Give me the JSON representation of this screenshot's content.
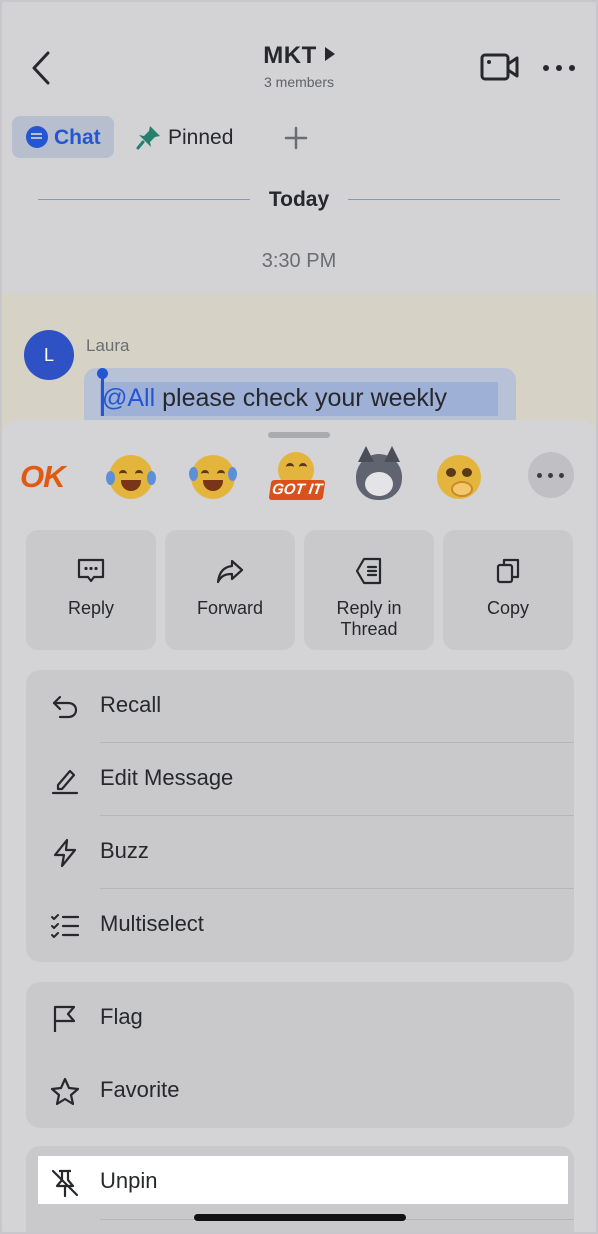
{
  "header": {
    "title": "MKT",
    "subtitle": "3 members"
  },
  "tabs": [
    {
      "label": "Chat"
    },
    {
      "label": "Pinned"
    }
  ],
  "date_divider": "Today",
  "timestamp": "3:30 PM",
  "message": {
    "avatar_initial": "L",
    "sender": "Laura",
    "mention": "@All",
    "text": " please check your weekly"
  },
  "reactions": [
    {
      "icon": "ok-sticker",
      "text": "OK"
    },
    {
      "icon": "crying-laughing-emoji"
    },
    {
      "icon": "tears-of-joy-emoji"
    },
    {
      "icon": "got-it-sticker",
      "text": "GOT IT"
    },
    {
      "icon": "husky-emoji"
    },
    {
      "icon": "pleading-face-emoji"
    },
    {
      "icon": "more-reactions-icon"
    }
  ],
  "actions": [
    {
      "label": "Reply",
      "icon": "reply-icon"
    },
    {
      "label": "Forward",
      "icon": "forward-icon"
    },
    {
      "label": "Reply in Thread",
      "icon": "thread-icon"
    },
    {
      "label": "Copy",
      "icon": "copy-icon"
    }
  ],
  "menu_group_1": [
    {
      "label": "Recall",
      "icon": "undo-icon"
    },
    {
      "label": "Edit Message",
      "icon": "pencil-icon"
    },
    {
      "label": "Buzz",
      "icon": "lightning-icon"
    },
    {
      "label": "Multiselect",
      "icon": "checklist-icon"
    }
  ],
  "menu_group_2": [
    {
      "label": "Flag",
      "icon": "flag-icon"
    },
    {
      "label": "Favorite",
      "icon": "star-icon"
    }
  ],
  "menu_group_3": [
    {
      "label": "Unpin",
      "icon": "unpin-icon"
    }
  ],
  "colors": {
    "accent": "#2456d3",
    "overlay_bg": "#d3d3d6",
    "sheet_card": "#c9c9cc",
    "highlight": "#ffffff"
  }
}
